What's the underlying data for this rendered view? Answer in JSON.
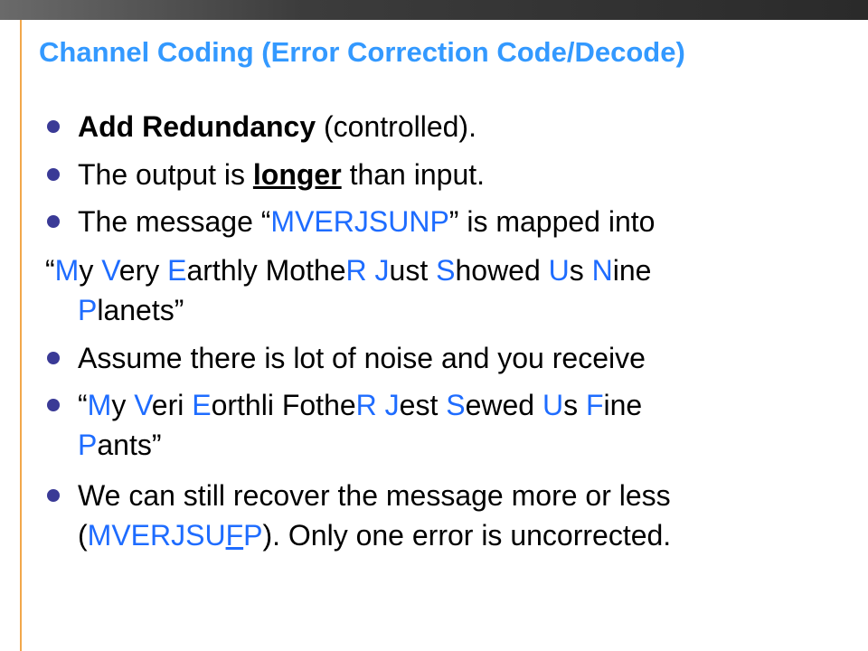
{
  "title": "Channel Coding (Error Correction Code/Decode)",
  "bullet1": {
    "bold": "Add Redundancy",
    "rest": " (controlled)."
  },
  "bullet2": {
    "pre": "The output is ",
    "em": "longer",
    "post": " than input."
  },
  "bullet3": {
    "pre": "The message “",
    "code": "MVERJSUNP",
    "post": "” is mapped into"
  },
  "mnemonic1": {
    "line1": [
      {
        "t": "“",
        "c": "black"
      },
      {
        "t": "M",
        "c": "blue"
      },
      {
        "t": "y ",
        "c": "black"
      },
      {
        "t": "V",
        "c": "blue"
      },
      {
        "t": "ery ",
        "c": "black"
      },
      {
        "t": "E",
        "c": "blue"
      },
      {
        "t": "arthly Mothe",
        "c": "black"
      },
      {
        "t": "R",
        "c": "blue"
      },
      {
        "t": " ",
        "c": "black"
      },
      {
        "t": "J",
        "c": "blue"
      },
      {
        "t": "ust ",
        "c": "black"
      },
      {
        "t": "S",
        "c": "blue"
      },
      {
        "t": "howed ",
        "c": "black"
      },
      {
        "t": "U",
        "c": "blue"
      },
      {
        "t": "s ",
        "c": "black"
      },
      {
        "t": "N",
        "c": "blue"
      },
      {
        "t": "ine",
        "c": "black"
      }
    ],
    "line2": [
      {
        "t": "P",
        "c": "blue"
      },
      {
        "t": "lanets”",
        "c": "black"
      }
    ]
  },
  "bullet4": "Assume there is lot of noise and you receive",
  "bullet5": {
    "line1": [
      {
        "t": "“",
        "c": "black"
      },
      {
        "t": "M",
        "c": "blue"
      },
      {
        "t": "y ",
        "c": "black"
      },
      {
        "t": "V",
        "c": "blue"
      },
      {
        "t": "eri ",
        "c": "black"
      },
      {
        "t": "E",
        "c": "blue"
      },
      {
        "t": "orthli Fothe",
        "c": "black"
      },
      {
        "t": "R",
        "c": "blue"
      },
      {
        "t": " ",
        "c": "black"
      },
      {
        "t": "J",
        "c": "blue"
      },
      {
        "t": "est ",
        "c": "black"
      },
      {
        "t": "S",
        "c": "blue"
      },
      {
        "t": "ewed ",
        "c": "black"
      },
      {
        "t": "U",
        "c": "blue"
      },
      {
        "t": "s ",
        "c": "black"
      },
      {
        "t": "F",
        "c": "blue"
      },
      {
        "t": "ine",
        "c": "black"
      }
    ],
    "line2": [
      {
        "t": "P",
        "c": "blue"
      },
      {
        "t": "ants”",
        "c": "black"
      }
    ]
  },
  "bullet6": {
    "line1": "We can still recover the message more or less",
    "open": "(",
    "code_a": "MVERJSU",
    "code_err": "F",
    "code_b": "P",
    "close": ").  Only one error is uncorrected."
  },
  "colors": {
    "title": "#3399ff",
    "accent": "#1e6cff",
    "bullet": "#3a3a96",
    "rule": "#f2a74b"
  }
}
